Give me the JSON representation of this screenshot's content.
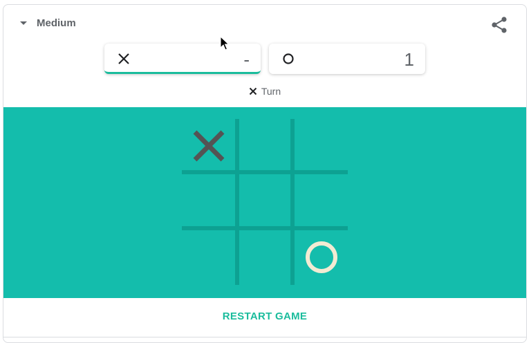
{
  "header": {
    "difficulty": "Medium",
    "share_icon": "share-icon"
  },
  "scoreboard": {
    "x": {
      "symbol": "X",
      "score": "-",
      "active": true
    },
    "o": {
      "symbol": "O",
      "score": "1",
      "active": false
    }
  },
  "status": {
    "turn_label": "Turn",
    "turn_player": "X"
  },
  "board": {
    "cells": [
      "X",
      "",
      "",
      "",
      "",
      "",
      "",
      "",
      "O"
    ]
  },
  "footer": {
    "restart_label": "RESTART GAME"
  },
  "colors": {
    "board_bg": "#14bdac",
    "grid_line": "#0da192",
    "x_mark": "#545454",
    "o_mark": "#f2ebd3",
    "accent": "#1abc9c"
  }
}
